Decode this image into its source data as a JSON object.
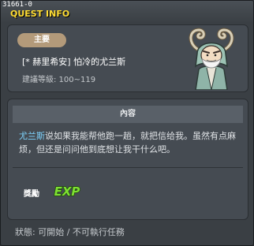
{
  "window": {
    "quest_id": "31661-0",
    "title": "QUEST INFO"
  },
  "quest": {
    "category": "主要",
    "name": "[* 赫里希安] 怕冷的尤兰斯",
    "level_range": "建議等級: 100~119",
    "npc_portrait_icon": "old-sage-npc-portrait"
  },
  "content": {
    "header": "內容",
    "npc_name": "尤兰斯",
    "description_rest": "说如果我能帮他跑一趟，就把信给我。虽然有点麻烦，但还是问问他到底想让我干什么吧。"
  },
  "reward": {
    "label": "獎勵",
    "exp_icon_text": "EXP",
    "exp_icon": "exp-reward-icon"
  },
  "status": {
    "text": "狀態:  可開始  / 不可執行任務"
  },
  "colors": {
    "title": "#ffdd33",
    "npc_link": "#7fd4ff",
    "badge": "#b39a7a",
    "exp": "#7ee032"
  }
}
